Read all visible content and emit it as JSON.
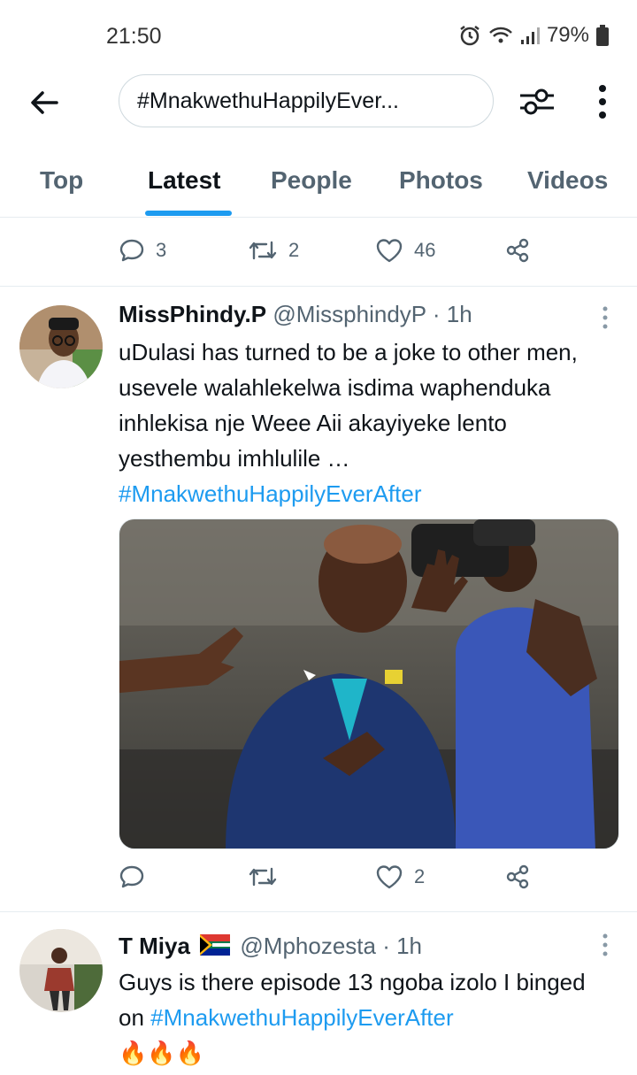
{
  "status_bar": {
    "time": "21:50",
    "battery": "79%"
  },
  "header": {
    "search_value": "#MnakwethuHappilyEver..."
  },
  "tabs": [
    {
      "label": "Top"
    },
    {
      "label": "Latest"
    },
    {
      "label": "People"
    },
    {
      "label": "Photos"
    },
    {
      "label": "Videos"
    }
  ],
  "active_tab": "Latest",
  "previous_tweet_actions": {
    "replies": "3",
    "retweets": "2",
    "likes": "46"
  },
  "tweets": [
    {
      "name": "MissPhindy.P",
      "handle": "@MissphindyP",
      "time": "· 1h",
      "text": "uDulasi has turned to be a joke to other men, usevele walahlekelwa isdima waphenduka inhlekisa nje Weee Aii akayiyeke lento yesthembu imhlulile …",
      "hashtag": "#MnakwethuHappilyEverAfter",
      "actions": {
        "replies": "",
        "retweets": "",
        "likes": "2"
      }
    },
    {
      "name": "T Miya",
      "handle": "@Mphozesta",
      "time": "· 1h",
      "text": "Guys is there episode 13 ngoba izolo I binged on ",
      "hashtag": "#MnakwethuHappilyEverAfter",
      "emoji": "🔥🔥🔥"
    }
  ],
  "colors": {
    "accent": "#1d9bf0",
    "text": "#0f1419",
    "muted": "#536471",
    "divider": "#e6ecf0"
  }
}
